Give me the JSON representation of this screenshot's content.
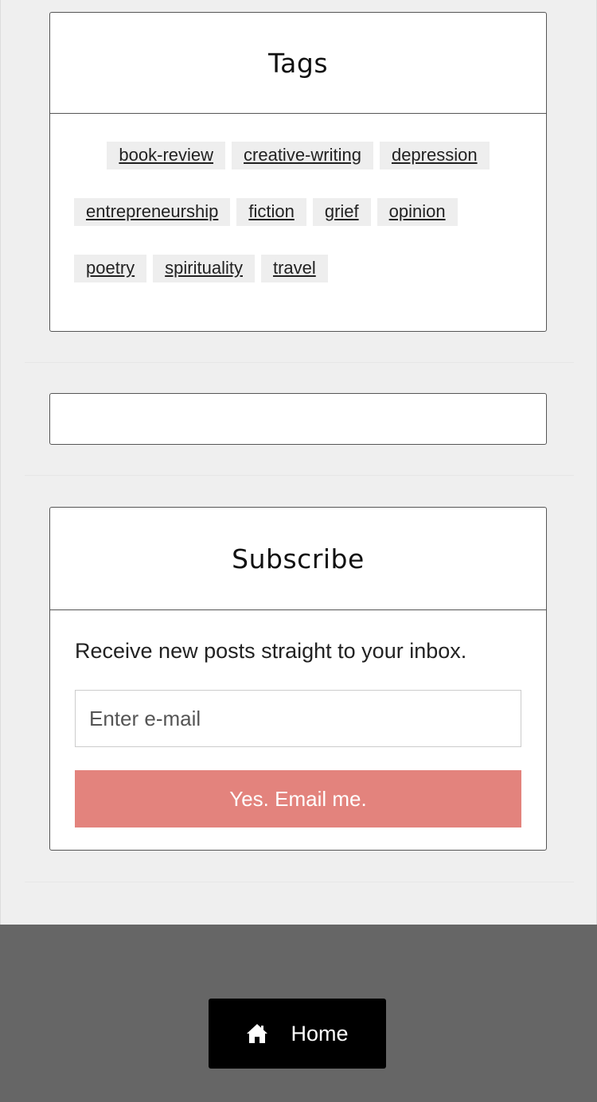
{
  "tags_widget": {
    "title": "Tags",
    "rows": [
      [
        "book-review",
        "creative-writing",
        "depression"
      ],
      [
        "entrepreneurship",
        "fiction",
        "grief",
        "opinion"
      ],
      [
        "poetry",
        "spirituality",
        "travel"
      ]
    ]
  },
  "subscribe_widget": {
    "title": "Subscribe",
    "text": "Receive new posts straight to your inbox.",
    "email_placeholder": "Enter e-mail",
    "button_label": "Yes. Email me."
  },
  "footer": {
    "home_label": "Home",
    "home_icon": "home-icon"
  },
  "colors": {
    "accent_button": "#e3837d",
    "footer_bg": "#666666",
    "page_bg": "#efefef"
  }
}
